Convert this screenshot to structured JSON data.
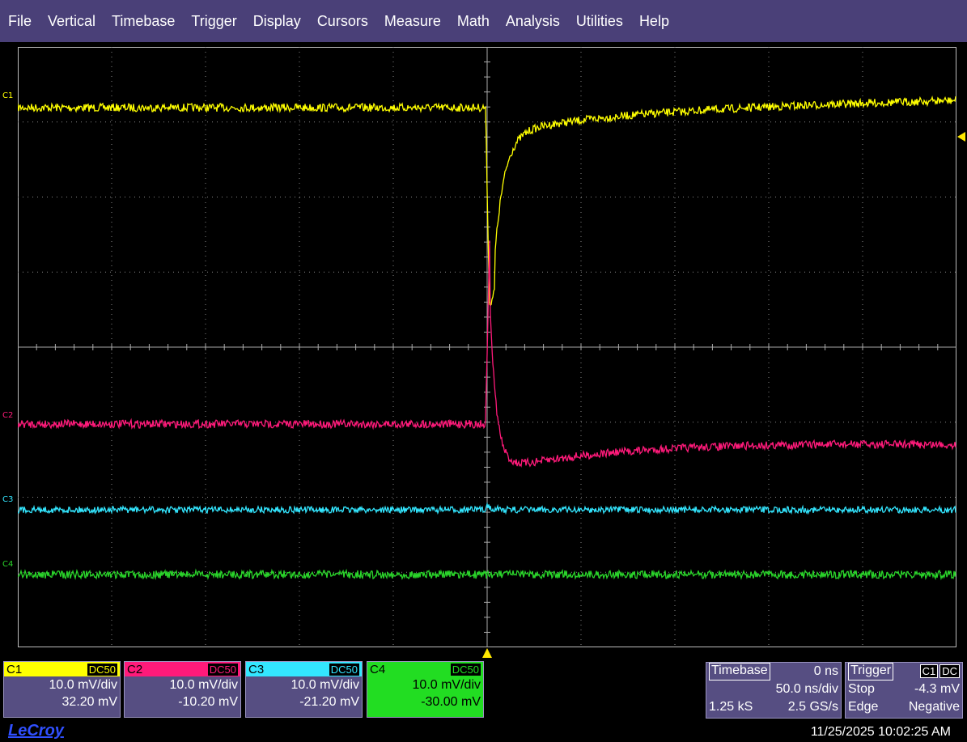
{
  "menu": [
    "File",
    "Vertical",
    "Timebase",
    "Trigger",
    "Display",
    "Cursors",
    "Measure",
    "Math",
    "Analysis",
    "Utilities",
    "Help"
  ],
  "channels": [
    {
      "id": "C1",
      "coupling": "DC50",
      "scale": "10.0 mV/div",
      "offset": "32.20 mV",
      "color": "#ffff00"
    },
    {
      "id": "C2",
      "coupling": "DC50",
      "scale": "10.0 mV/div",
      "offset": "-10.20 mV",
      "color": "#ff1a7a"
    },
    {
      "id": "C3",
      "coupling": "DC50",
      "scale": "10.0 mV/div",
      "offset": "-21.20 mV",
      "color": "#33e6ff"
    },
    {
      "id": "C4",
      "coupling": "DC50",
      "scale": "10.0 mV/div",
      "offset": "-30.00 mV",
      "color": "#2ad42a"
    }
  ],
  "timebase": {
    "title": "Timebase",
    "delay": "0 ns",
    "scale": "50.0 ns/div",
    "samples": "1.25 kS",
    "rate": "2.5 GS/s"
  },
  "trigger": {
    "title": "Trigger",
    "source": "C1",
    "coupling": "DC",
    "mode": "Stop",
    "level": "-4.3 mV",
    "type": "Edge",
    "slope": "Negative"
  },
  "brand": "LeCroy",
  "timestamp": "11/25/2025 10:02:25 AM"
}
